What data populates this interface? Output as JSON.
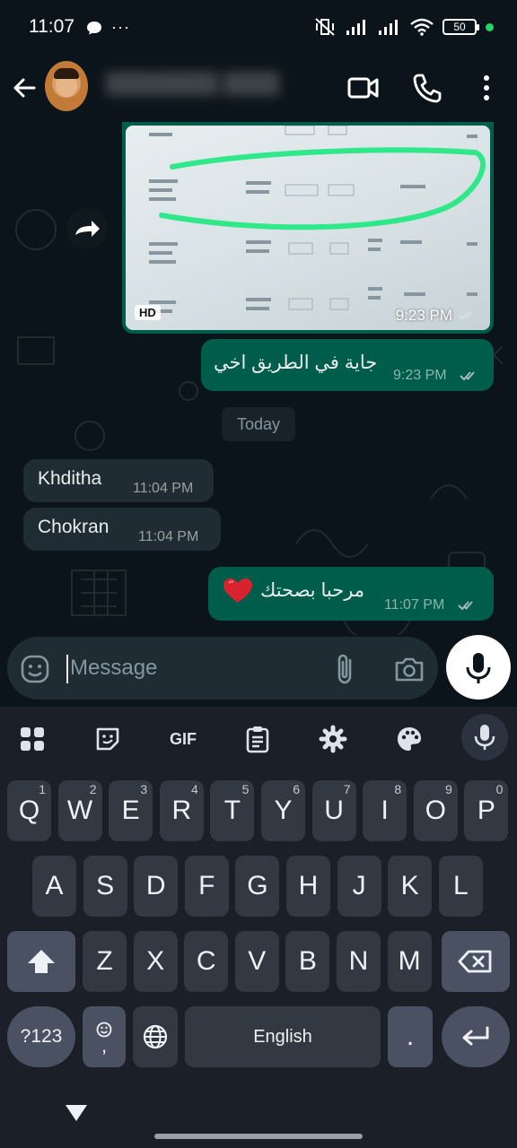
{
  "status_bar": {
    "time": "11:07",
    "more": "···",
    "battery": "50"
  },
  "header": {
    "contact_name": "████████ ████"
  },
  "chat": {
    "image_message": {
      "badge": "HD",
      "time": "9:23 PM"
    },
    "messages": [
      {
        "direction": "out",
        "text": "جاية في الطريق اخي",
        "time": "9:23 PM"
      },
      {
        "direction": "in",
        "text": "Khditha",
        "time": "11:04 PM"
      },
      {
        "direction": "in",
        "text": "Chokran",
        "time": "11:04 PM"
      },
      {
        "direction": "out",
        "text": "مرحبا بصحتك",
        "time": "11:07 PM"
      }
    ],
    "date_chip": "Today"
  },
  "composer": {
    "placeholder": "Message"
  },
  "keyboard": {
    "toolbar": {
      "gif_label": "GIF"
    },
    "rows": [
      [
        {
          "k": "Q",
          "h": "1"
        },
        {
          "k": "W",
          "h": "2"
        },
        {
          "k": "E",
          "h": "3"
        },
        {
          "k": "R",
          "h": "4"
        },
        {
          "k": "T",
          "h": "5"
        },
        {
          "k": "Y",
          "h": "6"
        },
        {
          "k": "U",
          "h": "7"
        },
        {
          "k": "I",
          "h": "8"
        },
        {
          "k": "O",
          "h": "9"
        },
        {
          "k": "P",
          "h": "0"
        }
      ],
      [
        "A",
        "S",
        "D",
        "F",
        "G",
        "H",
        "J",
        "K",
        "L"
      ],
      [
        "Z",
        "X",
        "C",
        "V",
        "B",
        "N",
        "M"
      ]
    ],
    "symbols_label": "?123",
    "comma_label": ",",
    "space_label": "English",
    "period_label": "."
  },
  "colors": {
    "bubble_out": "#005c4b",
    "bubble_in": "#202c33",
    "accent_green": "#25d366",
    "background": "#0b141a"
  }
}
